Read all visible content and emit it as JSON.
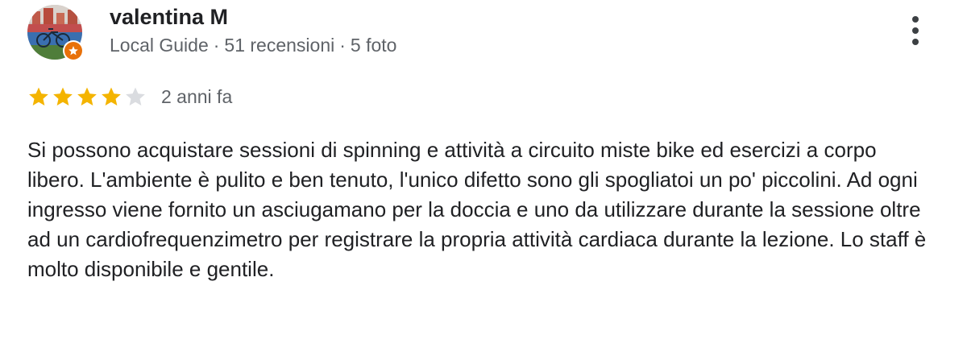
{
  "review": {
    "author": {
      "name": "valentina M",
      "badge": "Local Guide",
      "separator": "·",
      "reviews_count": "51 recensioni",
      "photos_count": "5 foto",
      "avatar_icon": "avatar-bicycle",
      "badge_icon": "local-guide-star-icon"
    },
    "rating": {
      "value": 4,
      "max": 5,
      "filled_color": "#f4b400",
      "empty_color": "#dadce0"
    },
    "date": "2 anni fa",
    "text": "Si possono acquistare sessioni di spinning e attività a circuito miste bike ed esercizi a corpo libero. L'ambiente è pulito e ben tenuto, l'unico difetto sono gli spogliatoi un po' piccolini. Ad ogni ingresso viene fornito un asciugamano per la doccia e uno da utilizzare durante la sessione oltre ad un cardiofrequenzimetro per registrare la propria attività cardiaca durante la lezione. Lo staff è molto disponibile e gentile.",
    "more_icon": "more-vert-icon",
    "badge_color": "#e8710a"
  }
}
